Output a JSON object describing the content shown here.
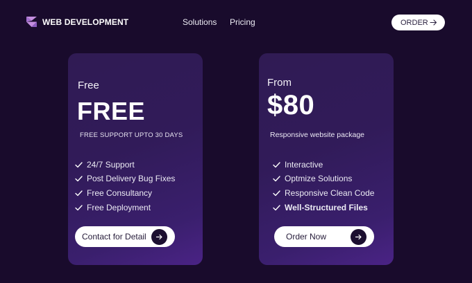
{
  "header": {
    "brand": "WEB DEVELOPMENT",
    "nav": [
      "Solutions",
      "Pricing"
    ],
    "order_label": "ORDER"
  },
  "plans": [
    {
      "label": "Free",
      "price": "FREE",
      "subtitle": "FREE SUPPORT UPTO 30 DAYS",
      "features": [
        "24/7 Support",
        "Post Delivery Bug Fixes",
        "Free Consultancy",
        "Free Deployment"
      ],
      "cta": "Contact for Detail"
    },
    {
      "label": "From",
      "price": "$80",
      "subtitle": "Responsive website package",
      "features": [
        "Interactive",
        "Optmize Solutions",
        "Responsive Clean Code",
        "Well-Structured Files"
      ],
      "cta": "Order Now"
    }
  ],
  "colors": {
    "background": "#190b2c",
    "card_gradient_start": "#301b54",
    "card_gradient_end": "#4a2385",
    "logo_accent": "#c48ee0",
    "button_bg": "#ffffff",
    "cta_circle": "#1c0f30"
  },
  "icons": [
    "logo-icon",
    "arrow-right-icon",
    "check-icon"
  ]
}
